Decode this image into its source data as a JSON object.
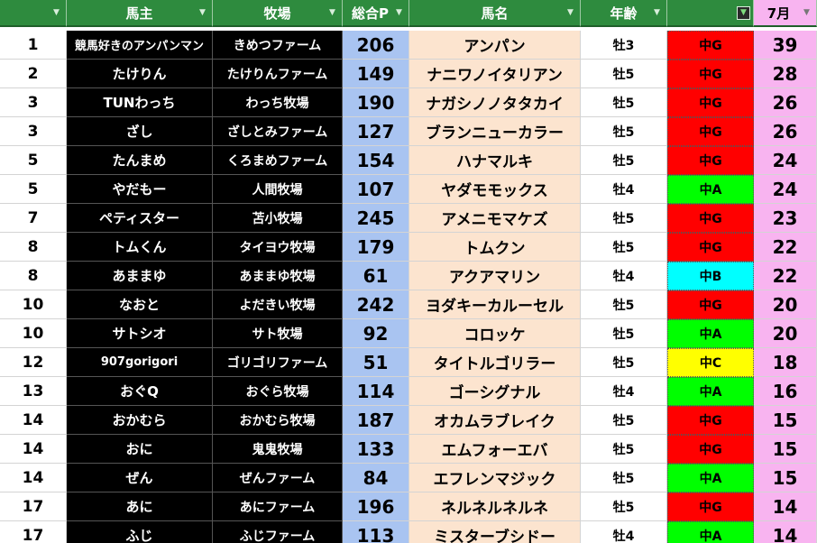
{
  "header": {
    "rank": "",
    "owner": "馬主",
    "ranch": "牧場",
    "points": "総合P",
    "horse": "馬名",
    "age": "年齢",
    "grade": "",
    "month": "7月"
  },
  "colors": {
    "header_green": "#2e8b3e",
    "points_blue": "#a9c4f1",
    "horse_peach": "#fce4cf",
    "month_pink": "#f8b4f0",
    "grade_red": "#ff0000",
    "grade_green": "#00ff00",
    "grade_cyan": "#00ffff",
    "grade_yellow": "#ffff00"
  },
  "rows": [
    {
      "rank": "1",
      "owner": "競馬好きのアンパンマン",
      "ranch": "きめつファーム",
      "points": "206",
      "horse": "アンパン",
      "age": "牡3",
      "grade": "中G",
      "grade_color": "red",
      "month": "39"
    },
    {
      "rank": "2",
      "owner": "たけりん",
      "ranch": "たけりんファーム",
      "points": "149",
      "horse": "ナニワノイタリアン",
      "age": "牡5",
      "grade": "中G",
      "grade_color": "red",
      "month": "28"
    },
    {
      "rank": "3",
      "owner": "TUNわっち",
      "ranch": "わっち牧場",
      "points": "190",
      "horse": "ナガシノノタタカイ",
      "age": "牡5",
      "grade": "中G",
      "grade_color": "red",
      "month": "26"
    },
    {
      "rank": "3",
      "owner": "ざし",
      "ranch": "ざしとみファーム",
      "points": "127",
      "horse": "ブランニューカラー",
      "age": "牡5",
      "grade": "中G",
      "grade_color": "red",
      "month": "26"
    },
    {
      "rank": "5",
      "owner": "たんまめ",
      "ranch": "くろまめファーム",
      "points": "154",
      "horse": "ハナマルキ",
      "age": "牡5",
      "grade": "中G",
      "grade_color": "red",
      "month": "24"
    },
    {
      "rank": "5",
      "owner": "やだもー",
      "ranch": "人間牧場",
      "points": "107",
      "horse": "ヤダモモックス",
      "age": "牡4",
      "grade": "中A",
      "grade_color": "green",
      "month": "24"
    },
    {
      "rank": "7",
      "owner": "ペティスター",
      "ranch": "苫小牧場",
      "points": "245",
      "horse": "アメニモマケズ",
      "age": "牡5",
      "grade": "中G",
      "grade_color": "red",
      "month": "23"
    },
    {
      "rank": "8",
      "owner": "トムくん",
      "ranch": "タイヨウ牧場",
      "points": "179",
      "horse": "トムクン",
      "age": "牡5",
      "grade": "中G",
      "grade_color": "red",
      "month": "22"
    },
    {
      "rank": "8",
      "owner": "あままゆ",
      "ranch": "あままゆ牧場",
      "points": "61",
      "horse": "アクアマリン",
      "age": "牡4",
      "grade": "中B",
      "grade_color": "cyan",
      "month": "22"
    },
    {
      "rank": "10",
      "owner": "なおと",
      "ranch": "よだきい牧場",
      "points": "242",
      "horse": "ヨダキーカルーセル",
      "age": "牡5",
      "grade": "中G",
      "grade_color": "red",
      "month": "20"
    },
    {
      "rank": "10",
      "owner": "サトシオ",
      "ranch": "サト牧場",
      "points": "92",
      "horse": "コロッケ",
      "age": "牡5",
      "grade": "中A",
      "grade_color": "green",
      "month": "20"
    },
    {
      "rank": "12",
      "owner": "907gorigori",
      "ranch": "ゴリゴリファーム",
      "points": "51",
      "horse": "タイトルゴリラー",
      "age": "牡5",
      "grade": "中C",
      "grade_color": "yellow",
      "month": "18"
    },
    {
      "rank": "13",
      "owner": "おぐQ",
      "ranch": "おぐら牧場",
      "points": "114",
      "horse": "ゴーシグナル",
      "age": "牡4",
      "grade": "中A",
      "grade_color": "green",
      "month": "16"
    },
    {
      "rank": "14",
      "owner": "おかむら",
      "ranch": "おかむら牧場",
      "points": "187",
      "horse": "オカムラブレイク",
      "age": "牡5",
      "grade": "中G",
      "grade_color": "red",
      "month": "15"
    },
    {
      "rank": "14",
      "owner": "おに",
      "ranch": "鬼鬼牧場",
      "points": "133",
      "horse": "エムフォーエバ",
      "age": "牡5",
      "grade": "中G",
      "grade_color": "red",
      "month": "15"
    },
    {
      "rank": "14",
      "owner": "ぜん",
      "ranch": "ぜんファーム",
      "points": "84",
      "horse": "エフレンマジック",
      "age": "牡5",
      "grade": "中A",
      "grade_color": "green",
      "month": "15"
    },
    {
      "rank": "17",
      "owner": "あに",
      "ranch": "あにファーム",
      "points": "196",
      "horse": "ネルネルネルネ",
      "age": "牡5",
      "grade": "中G",
      "grade_color": "red",
      "month": "14"
    },
    {
      "rank": "17",
      "owner": "ふじ",
      "ranch": "ふじファーム",
      "points": "113",
      "horse": "ミスターブシドー",
      "age": "牡4",
      "grade": "中A",
      "grade_color": "green",
      "month": "14"
    }
  ]
}
